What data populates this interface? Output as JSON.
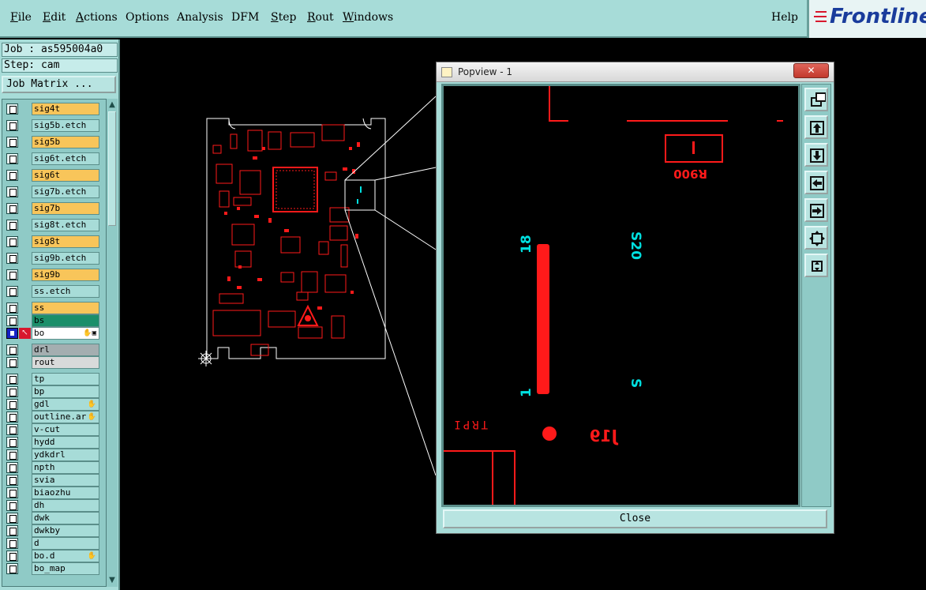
{
  "menubar": {
    "items": [
      {
        "label": "File",
        "key": "F",
        "rest": "ile"
      },
      {
        "label": "Edit",
        "key": "E",
        "rest": "dit"
      },
      {
        "label": "Actions",
        "key": "A",
        "rest": "ctions"
      },
      {
        "label": "Options",
        "key": "",
        "rest": "Options"
      },
      {
        "label": "Analysis",
        "key": "",
        "rest": "Analysis"
      },
      {
        "label": "DFM",
        "key": "",
        "rest": "DFM"
      },
      {
        "label": "Step",
        "key": "S",
        "rest": "tep"
      },
      {
        "label": "Rout",
        "key": "R",
        "rest": "out"
      },
      {
        "label": "Windows",
        "key": "W",
        "rest": "indows"
      }
    ],
    "help": "Help",
    "logo": "Frontline"
  },
  "left_panel": {
    "job": "Job : as595004a0",
    "step": "Step: cam",
    "job_matrix_button": "Job Matrix ..."
  },
  "layers": [
    {
      "name": "sig4t",
      "style": "signal"
    },
    {
      "name": "sig5b.etch",
      "style": "plain"
    },
    {
      "name": "sig5b",
      "style": "signal"
    },
    {
      "name": "sig6t.etch",
      "style": "plain"
    },
    {
      "name": "sig6t",
      "style": "signal"
    },
    {
      "name": "sig7b.etch",
      "style": "plain"
    },
    {
      "name": "sig7b",
      "style": "signal"
    },
    {
      "name": "sig8t.etch",
      "style": "plain"
    },
    {
      "name": "sig8t",
      "style": "signal"
    },
    {
      "name": "sig9b.etch",
      "style": "plain"
    },
    {
      "name": "sig9b",
      "style": "signal"
    },
    {
      "name": "ss.etch",
      "style": "plain"
    },
    {
      "name": "ss",
      "style": "signal"
    },
    {
      "name": "bs",
      "style": "green"
    },
    {
      "name": "bo",
      "style": "white",
      "active": true
    },
    {
      "name": "drl",
      "style": "grey"
    },
    {
      "name": "rout",
      "style": "lightgrey"
    },
    {
      "name": "tp",
      "style": "plain"
    },
    {
      "name": "bp",
      "style": "plain"
    },
    {
      "name": "gdl",
      "style": "plain",
      "flag": true
    },
    {
      "name": "outline.ar",
      "style": "plain",
      "flag": true
    },
    {
      "name": "v-cut",
      "style": "plain"
    },
    {
      "name": "hydd",
      "style": "plain"
    },
    {
      "name": "ydkdrl",
      "style": "plain"
    },
    {
      "name": "npth",
      "style": "plain"
    },
    {
      "name": "svia",
      "style": "plain"
    },
    {
      "name": "biaozhu",
      "style": "plain"
    },
    {
      "name": "dh",
      "style": "plain"
    },
    {
      "name": "dwk",
      "style": "plain"
    },
    {
      "name": "dwkby",
      "style": "plain"
    },
    {
      "name": "d",
      "style": "plain"
    },
    {
      "name": "bo.d",
      "style": "plain",
      "flag": true
    },
    {
      "name": "bo_map",
      "style": "plain"
    }
  ],
  "popview": {
    "title": "Popview - 1",
    "close_x": "✕",
    "close_button": "Close",
    "tools": [
      "zoom-window-icon",
      "pan-up-icon",
      "pan-down-icon",
      "pan-left-icon",
      "pan-right-icon",
      "zoom-home-icon",
      "fit-icon"
    ],
    "labels": {
      "ref1": "1",
      "r900": "R900",
      "pin18": "18",
      "pin1": "1",
      "s20": "S20",
      "s": "S",
      "trpi": "TRPI",
      "j19": "J19"
    }
  },
  "colors": {
    "copper": "#ff1a1a",
    "silkscreen": "#00e0e0",
    "ui_bg": "#a7dcd8",
    "signal_layer": "#f8c55a",
    "board_outline": "#ffffff"
  }
}
